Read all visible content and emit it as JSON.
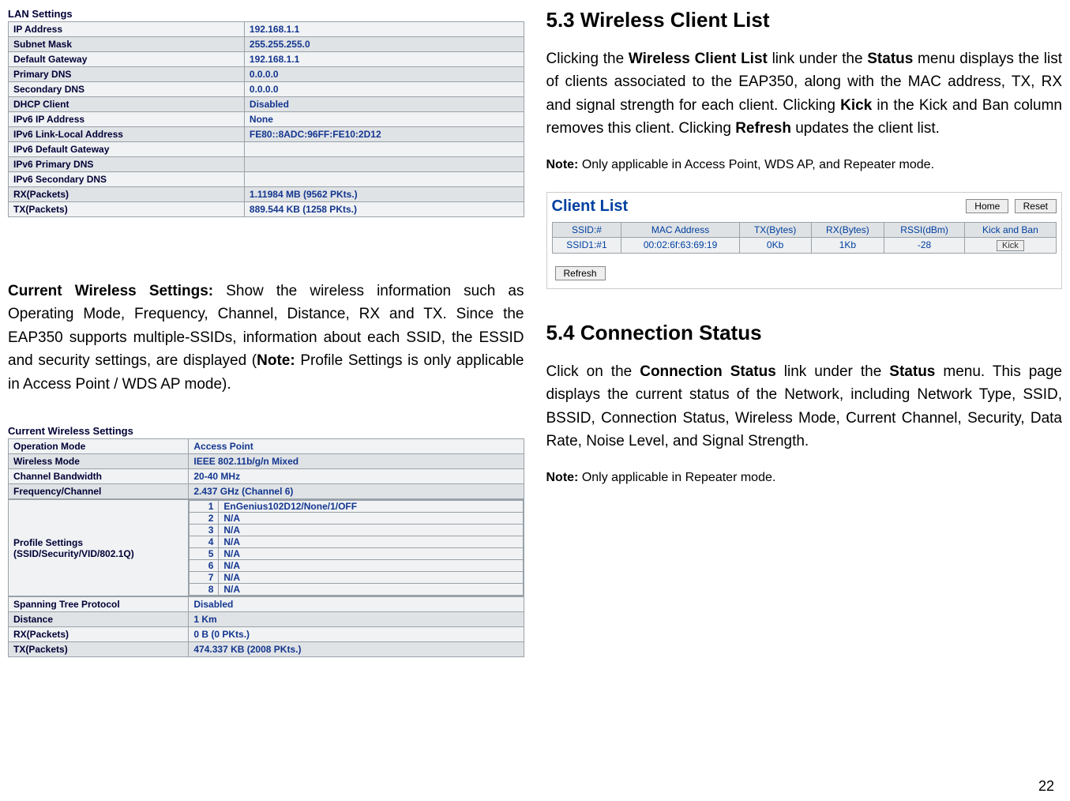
{
  "page_number": "22",
  "left": {
    "lan_title": "LAN Settings",
    "lan_rows": [
      {
        "k": "IP Address",
        "v": "192.168.1.1"
      },
      {
        "k": "Subnet Mask",
        "v": "255.255.255.0"
      },
      {
        "k": "Default Gateway",
        "v": "192.168.1.1"
      },
      {
        "k": "Primary DNS",
        "v": "0.0.0.0"
      },
      {
        "k": "Secondary DNS",
        "v": "0.0.0.0"
      },
      {
        "k": "DHCP Client",
        "v": "Disabled"
      },
      {
        "k": "IPv6 IP Address",
        "v": "None"
      },
      {
        "k": "IPv6 Link-Local Address",
        "v": "FE80::8ADC:96FF:FE10:2D12"
      },
      {
        "k": "IPv6 Default Gateway",
        "v": ""
      },
      {
        "k": "IPv6 Primary DNS",
        "v": ""
      },
      {
        "k": "IPv6 Secondary DNS",
        "v": ""
      },
      {
        "k": "RX(Packets)",
        "v": "1.11984 MB (9562 PKts.)"
      },
      {
        "k": "TX(Packets)",
        "v": "889.544 KB (1258 PKts.)"
      }
    ],
    "para1_label": "Current Wireless Settings:",
    "para1_body_a": " Show the wireless information such as Operating Mode, Frequency, Channel, Distance, RX and TX. Since the EAP350 supports multiple-SSIDs, information about each SSID, the ESSID and security settings, are displayed (",
    "para1_note_label": "Note:",
    "para1_body_b": " Profile Settings is only applicable in Access Point / WDS AP mode).",
    "cws_title": "Current Wireless Settings",
    "cws_rows": [
      {
        "k": "Operation Mode",
        "v": "Access Point"
      },
      {
        "k": "Wireless Mode",
        "v": "IEEE 802.11b/g/n Mixed"
      },
      {
        "k": "Channel Bandwidth",
        "v": "20-40 MHz"
      },
      {
        "k": "Frequency/Channel",
        "v": "2.437 GHz (Channel 6)"
      }
    ],
    "profile_label": "Profile Settings\n(SSID/Security/VID/802.1Q)",
    "profile_rows": [
      {
        "i": "1",
        "v": "EnGenius102D12/None/1/OFF"
      },
      {
        "i": "2",
        "v": "N/A"
      },
      {
        "i": "3",
        "v": "N/A"
      },
      {
        "i": "4",
        "v": "N/A"
      },
      {
        "i": "5",
        "v": "N/A"
      },
      {
        "i": "6",
        "v": "N/A"
      },
      {
        "i": "7",
        "v": "N/A"
      },
      {
        "i": "8",
        "v": "N/A"
      }
    ],
    "cws_tail": [
      {
        "k": "Spanning Tree Protocol",
        "v": "Disabled"
      },
      {
        "k": "Distance",
        "v": "1 Km"
      },
      {
        "k": "RX(Packets)",
        "v": "0 B (0 PKts.)"
      },
      {
        "k": "TX(Packets)",
        "v": "474.337 KB (2008 PKts.)"
      }
    ]
  },
  "right": {
    "h53": "5.3  Wireless Client List",
    "p53_a": "Clicking the ",
    "p53_b": "Wireless Client List",
    "p53_c": " link under the ",
    "p53_d": "Status",
    "p53_e": " menu displays the list of clients associated to the EAP350, along with the MAC address, TX, RX and signal strength for each client. Clicking ",
    "p53_f": "Kick",
    "p53_g": " in the Kick and Ban column removes this client. Clicking ",
    "p53_h": "Refresh",
    "p53_i": " updates the client list.",
    "note53_label": "Note:",
    "note53_body": " Only applicable in Access Point, WDS AP, and Repeater mode.",
    "client_list_title": "Client List",
    "btn_home": "Home",
    "btn_reset": "Reset",
    "cl_headers": {
      "ssid": "SSID:#",
      "mac": "MAC Address",
      "tx": "TX(Bytes)",
      "rx": "RX(Bytes)",
      "rssi": "RSSI(dBm)",
      "kick": "Kick and Ban"
    },
    "cl_row": {
      "ssid": "SSID1:#1",
      "mac": "00:02:6f:63:69:19",
      "tx": "0Kb",
      "rx": "1Kb",
      "rssi": "-28"
    },
    "kick_label": "Kick",
    "btn_refresh": "Refresh",
    "h54": "5.4  Connection Status",
    "p54_a": "Click on the ",
    "p54_b": "Connection Status",
    "p54_c": " link under the ",
    "p54_d": "Status",
    "p54_e": " menu. This page displays the current status of the Network, including Network Type, SSID, BSSID, Connection Status, Wireless Mode, Current Channel, Security, Data Rate, Noise Level, and Signal Strength.",
    "note54_label": "Note:",
    "note54_body": " Only applicable in Repeater mode."
  }
}
